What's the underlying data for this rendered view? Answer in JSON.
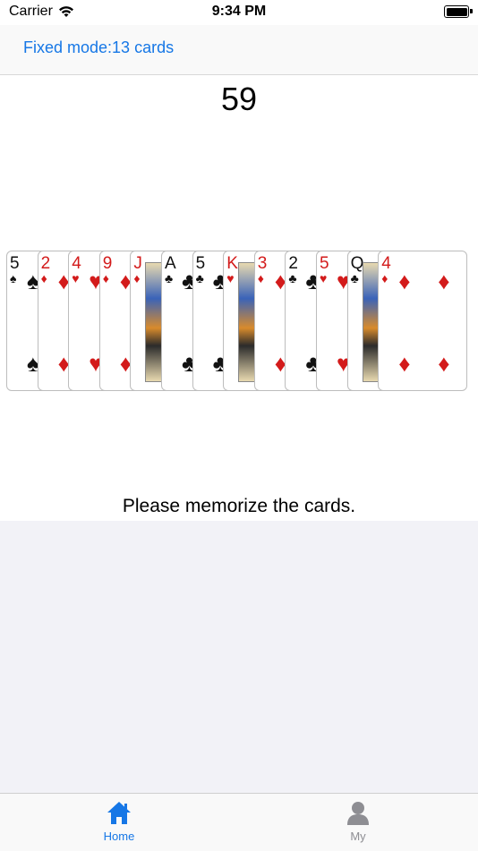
{
  "status_bar": {
    "carrier": "Carrier",
    "time": "9:34 PM"
  },
  "nav": {
    "title": "Fixed mode:13 cards"
  },
  "counter": "59",
  "instruction": "Please memorize the cards.",
  "cards": [
    {
      "rank": "5",
      "suit": "♠",
      "color": "black"
    },
    {
      "rank": "2",
      "suit": "♦",
      "color": "red"
    },
    {
      "rank": "4",
      "suit": "♥",
      "color": "red"
    },
    {
      "rank": "9",
      "suit": "♦",
      "color": "red"
    },
    {
      "rank": "J",
      "suit": "♦",
      "color": "red",
      "face": true
    },
    {
      "rank": "A",
      "suit": "♣",
      "color": "black"
    },
    {
      "rank": "5",
      "suit": "♣",
      "color": "black"
    },
    {
      "rank": "K",
      "suit": "♥",
      "color": "red",
      "face": true
    },
    {
      "rank": "3",
      "suit": "♦",
      "color": "red"
    },
    {
      "rank": "2",
      "suit": "♣",
      "color": "black"
    },
    {
      "rank": "5",
      "suit": "♥",
      "color": "red"
    },
    {
      "rank": "Q",
      "suit": "♣",
      "color": "black",
      "face": true
    },
    {
      "rank": "4",
      "suit": "♦",
      "color": "red"
    }
  ],
  "tabs": [
    {
      "label": "Home",
      "icon": "home-icon",
      "active": true
    },
    {
      "label": "My",
      "icon": "person-icon",
      "active": false
    }
  ]
}
